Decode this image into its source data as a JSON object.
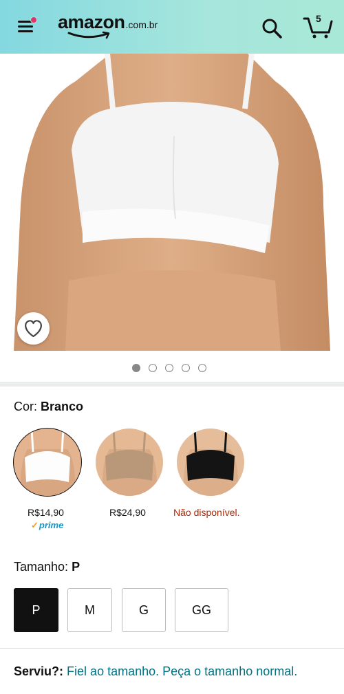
{
  "header": {
    "logo_word": "amazon",
    "logo_tld": ".com.br",
    "cart_count": "5",
    "colors": {
      "gradient_start": "#84d8e0",
      "gradient_end": "#a8e8d6",
      "notification_dot": "#e0336a"
    }
  },
  "icons": {
    "menu": "hamburger-menu-icon",
    "search": "search-icon",
    "cart": "cart-icon",
    "wishlist": "heart-icon"
  },
  "gallery": {
    "image_count": 5,
    "active_index": 0
  },
  "color": {
    "label": "Cor:",
    "selected": "Branco",
    "options": [
      {
        "name": "Branco",
        "price": "R$14,90",
        "prime": "prime",
        "selected": true
      },
      {
        "name": "Bege",
        "price": "R$24,90"
      },
      {
        "name": "Preto",
        "price": "Não disponível."
      }
    ]
  },
  "size": {
    "label": "Tamanho:",
    "selected": "P",
    "options": [
      "P",
      "M",
      "G",
      "GG"
    ]
  },
  "fit": {
    "label": "Serviu?:",
    "text": "Fiel ao tamanho. Peça o tamanho normal."
  }
}
